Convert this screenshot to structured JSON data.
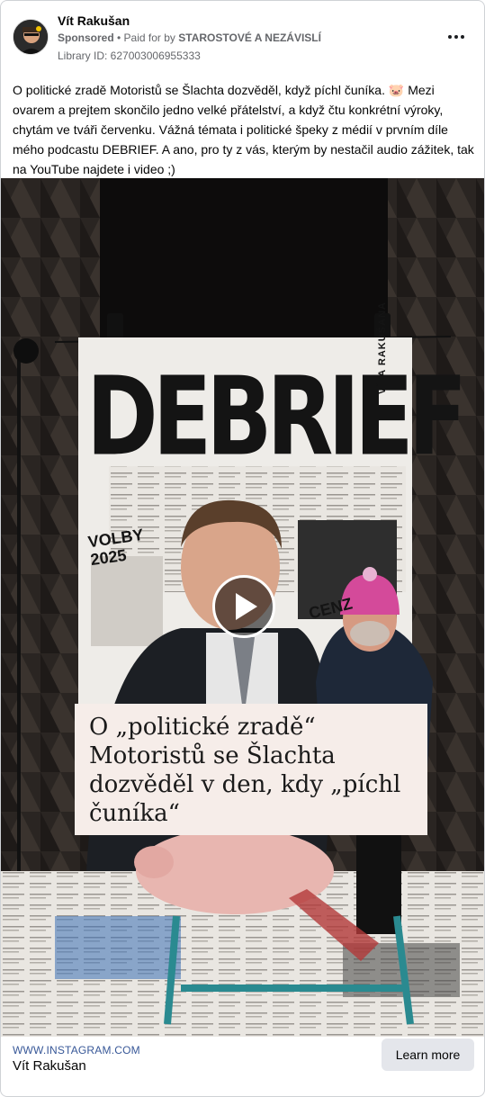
{
  "header": {
    "page_name": "Vít Rakušan",
    "sponsored_label": "Sponsored",
    "paid_for_prefix": "• Paid for by",
    "paid_for_name": "STAROSTOVÉ A NEZÁVISLÍ",
    "library_id": "Library ID: 627003006955333",
    "more_icon": "more-horizontal-icon"
  },
  "ad_text": "O politické zradě Motoristů se Šlachta dozvěděl, když píchl čuníka. 🐷 Mezi ovarem a prejtem skončilo jedno velké přátelství, a když čtu konkrétní výroky, chytám ve tváři červenku. Vážná témata i politické špeky z médií v prvním díle mého podcastu DEBRIEF. A ano, pro ty z vás, kterým by nestačil audio zážitek, tak na YouTube najdete i video ;)",
  "media": {
    "poster_title": "DEBRIEF",
    "poster_side_text": "VÍTA RAKUŠANA",
    "poster_volby": "VOLBY\n2025",
    "poster_fragment": "CENZ",
    "caption": "O „politické zradě“ Motoristů se Šlachta dozvěděl v den, kdy „píchl čuníka“",
    "play_icon": "play-icon"
  },
  "footer": {
    "url": "WWW.INSTAGRAM.COM",
    "name": "Vít Rakušan",
    "cta_label": "Learn more"
  }
}
